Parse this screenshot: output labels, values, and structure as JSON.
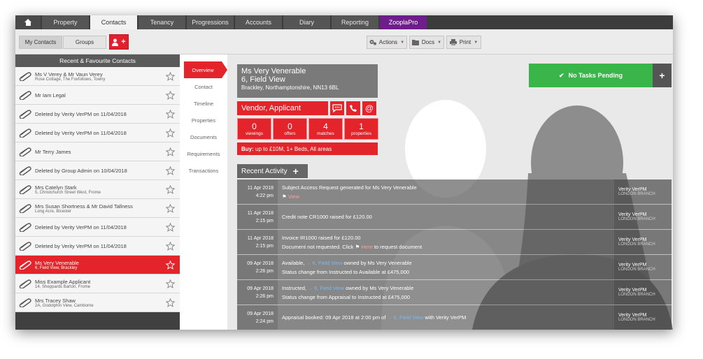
{
  "nav": {
    "tabs": [
      {
        "label": "Property"
      },
      {
        "label": "Contacts"
      },
      {
        "label": "Tenancy"
      },
      {
        "label": "Progressions"
      },
      {
        "label": "Accounts"
      },
      {
        "label": "Diary"
      },
      {
        "label": "Reporting"
      },
      {
        "label": "ZooplaPro"
      }
    ]
  },
  "toolbar": {
    "my_contacts": "My Contacts",
    "groups": "Groups",
    "add_contact": "+",
    "actions": "Actions",
    "docs": "Docs",
    "print": "Print"
  },
  "left_panel": {
    "header": "Recent & Favourite Contacts",
    "contacts": [
      {
        "name": "Ms V Verey & Mr Vaun Verey",
        "address": "Rose Cottage, The Foxfollows, Towny"
      },
      {
        "name": "Mr Iam Legal",
        "address": ""
      },
      {
        "name": "Deleted by Verity VerPM on 11/04/2018",
        "address": ""
      },
      {
        "name": "Deleted by Verity VerPM on 11/04/2018",
        "address": ""
      },
      {
        "name": "Mr Terry James",
        "address": ""
      },
      {
        "name": "Deleted by Group Admin on 10/04/2018",
        "address": ""
      },
      {
        "name": "Mrs Catelyn Stark",
        "address": "5, Christchurch Street West, Frome"
      },
      {
        "name": "Mrs Susan Shortness & Mr David Tallness",
        "address": "Long Acre, Bicester"
      },
      {
        "name": "Deleted by Verity VerPM on 11/04/2018",
        "address": ""
      },
      {
        "name": "Deleted by Verity VerPM on 11/04/2018",
        "address": ""
      },
      {
        "name": "Ms Very Venerable",
        "address": "6, Field View, Brackley"
      },
      {
        "name": "Miss Example Applicant",
        "address": "14, Sheppards Barton, Frome"
      },
      {
        "name": "Mrs Tracey Shaw",
        "address": "2A, Godolphin View, Camborne"
      }
    ]
  },
  "side_nav": {
    "items": [
      {
        "label": "Overview"
      },
      {
        "label": "Contact"
      },
      {
        "label": "Timeline"
      },
      {
        "label": "Properties"
      },
      {
        "label": "Documents"
      },
      {
        "label": "Requirements"
      },
      {
        "label": "Transactions"
      }
    ]
  },
  "contact": {
    "name": "Ms Very Venerable",
    "address_line": "6, Field View",
    "locality": "Brackley, Northamptonshire, NN13 6BL",
    "role": "Vendor, Applicant",
    "stats": [
      {
        "value": "0",
        "label": "viewings"
      },
      {
        "value": "0",
        "label": "offers"
      },
      {
        "value": "4",
        "label": "matches"
      },
      {
        "value": "1",
        "label": "properties"
      }
    ],
    "buy_label": "Buy:",
    "buy_text": "up to £10M, 1+ Beds, All areas"
  },
  "tasks": {
    "label": "No Tasks Pending",
    "add": "+"
  },
  "activity": {
    "title": "Recent Activity",
    "add": "+",
    "rows": [
      {
        "date": "11 Apr 2018",
        "time": "4:22 pm",
        "line1": "Subject Access Request generated for Ms Very Venerable",
        "line2_link": "View",
        "user": "Verity VerPM",
        "branch": "LONDON BRANCH"
      },
      {
        "date": "11 Apr 2018",
        "time": "2:15 pm",
        "line1": "Credit note CR1000 raised for £120.00",
        "user": "Verity VerPM",
        "branch": "LONDON BRANCH"
      },
      {
        "date": "11 Apr 2018",
        "time": "2:15 pm",
        "line1": "Invoice IR1000 raised for £120.00",
        "line2_pre": "Document not requested. Click",
        "line2_link": "Here",
        "line2_post": "to request document",
        "user": "Verity VerPM",
        "branch": "LONDON BRANCH"
      },
      {
        "date": "09 Apr 2018",
        "time": "2:26 pm",
        "line1_pre": "Available,",
        "line1_link": "6, Field View",
        "line1_post": "owned by Ms Very Venerable",
        "line2": "Status change from Instructed to Available at £475,000",
        "user": "Verity VerPM",
        "branch": "LONDON BRANCH"
      },
      {
        "date": "09 Apr 2018",
        "time": "2:26 pm",
        "line1_pre": "Instructed,",
        "line1_link": "6, Field View",
        "line1_post": "owned by Ms Very Venerable",
        "line2": "Status change from Appraisal to Instructed at £475,000",
        "user": "Verity VerPM",
        "branch": "LONDON BRANCH"
      },
      {
        "date": "09 Apr 2018",
        "time": "2:24 pm",
        "line1_pre": "Appraisal booked: 09 Apr 2018 at 2:00 pm of",
        "line1_link": "6, Field View",
        "line1_post": "with Verity VerPM",
        "user": "Verity VerPM",
        "branch": "LONDON BRANCH"
      }
    ]
  },
  "colors": {
    "accent_red": "#e3242b",
    "success_green": "#3ab54a",
    "zoopla_purple": "#6e1e8a"
  }
}
